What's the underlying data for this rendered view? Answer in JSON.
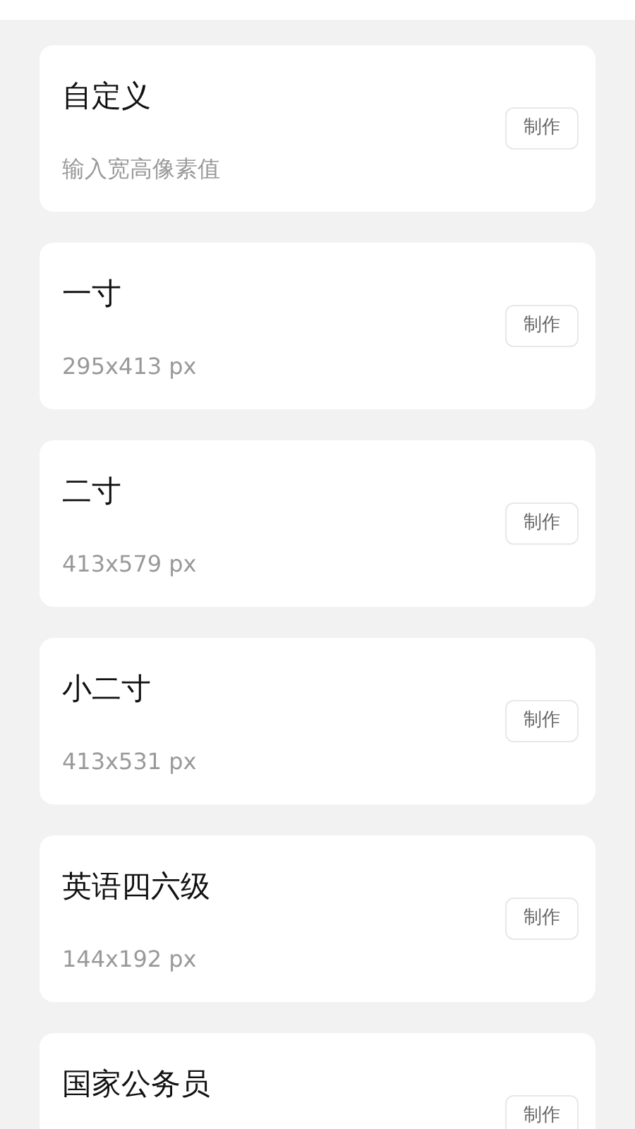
{
  "items": [
    {
      "title": "自定义",
      "subtitle": "输入宽高像素值",
      "button": "制作"
    },
    {
      "title": "一寸",
      "subtitle": "295x413 px",
      "button": "制作"
    },
    {
      "title": "二寸",
      "subtitle": "413x579 px",
      "button": "制作"
    },
    {
      "title": "小二寸",
      "subtitle": "413x531 px",
      "button": "制作"
    },
    {
      "title": "英语四六级",
      "subtitle": "144x192 px",
      "button": "制作"
    },
    {
      "title": "国家公务员",
      "button": "制作"
    }
  ]
}
